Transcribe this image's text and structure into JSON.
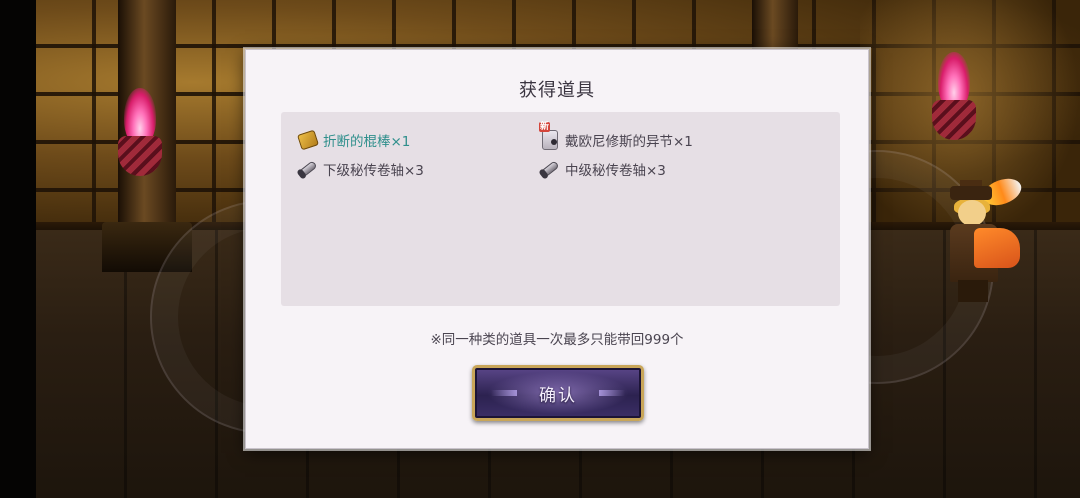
{
  "dialog": {
    "title": "获得道具",
    "items": [
      {
        "label": "折断的棍棒×1",
        "icon": "broken-staff-icon",
        "highlight": true,
        "is_new": false
      },
      {
        "label": "戴欧尼修斯的异节×1",
        "icon": "book-icon",
        "highlight": false,
        "is_new": true,
        "badge": "新"
      },
      {
        "label": "下级秘传卷轴×3",
        "icon": "scroll-icon",
        "highlight": false,
        "is_new": false
      },
      {
        "label": "中级秘传卷轴×3",
        "icon": "scroll-icon",
        "highlight": false,
        "is_new": false
      }
    ],
    "note": "※同一种类的道具一次最多只能带回999个",
    "confirm_label": "确认"
  },
  "colors": {
    "highlight_text": "#2f8f8c",
    "button_border": "#c9a659",
    "button_fill": "#2c2250",
    "torch_flame": "#ff6fb8"
  }
}
